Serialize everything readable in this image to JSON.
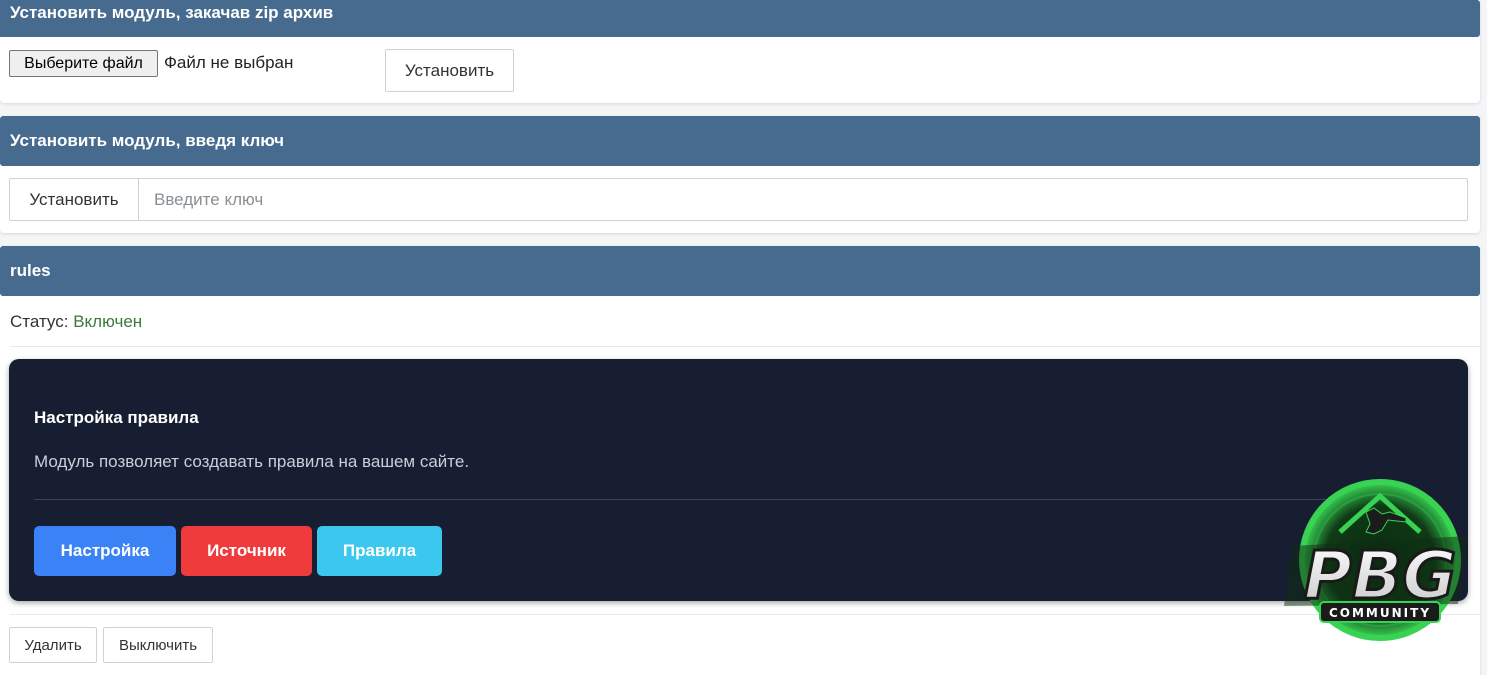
{
  "zip_install": {
    "title": "Установить модуль, закачав zip архив",
    "file_button_label": "Выберите файл",
    "file_status": "Файл не выбран",
    "install_label": "Установить"
  },
  "key_install": {
    "title": "Установить модуль, введя ключ",
    "install_label": "Установить",
    "key_placeholder": "Введите ключ",
    "key_value": ""
  },
  "module": {
    "name": "rules",
    "status_label": "Статус:",
    "status_value": "Включен",
    "panel": {
      "title": "Настройка правила",
      "description": "Модуль позволяет создавать правила на вашем сайте.",
      "buttons": {
        "settings": "Настройка",
        "source": "Источник",
        "rules": "Правила"
      }
    },
    "delete_label": "Удалить",
    "disable_label": "Выключить"
  },
  "watermark": {
    "text": "PBG",
    "subtext": "COMMUNITY"
  },
  "colors": {
    "header_bg": "#476b8f",
    "panel_bg": "#171e31",
    "status_enabled": "#3b7a3b",
    "btn_settings": "#3b82f6",
    "btn_source": "#ef3b3b",
    "btn_rules": "#3cc8ee",
    "logo_green": "#39d353"
  },
  "icons": {
    "logo": "pbg-community-logo"
  }
}
